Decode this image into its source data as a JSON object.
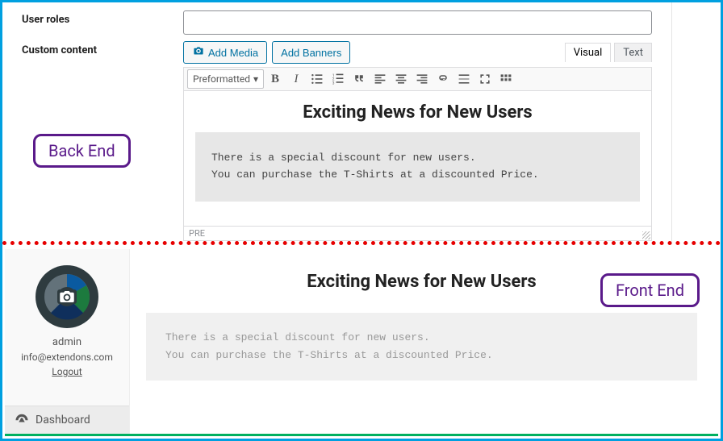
{
  "backend": {
    "fields": {
      "user_roles_label": "User roles",
      "user_roles_value": "",
      "custom_content_label": "Custom content"
    },
    "buttons": {
      "add_media": "Add Media",
      "add_banners": "Add Banners"
    },
    "editor": {
      "tabs": {
        "visual": "Visual",
        "text": "Text",
        "active": "visual"
      },
      "format_selected": "Preformatted",
      "status_path": "PRE",
      "icon_names": {
        "bold": "bold-icon",
        "italic": "italic-icon",
        "bullet_list": "bullet-list-icon",
        "number_list": "numbered-list-icon",
        "blockquote": "blockquote-icon",
        "align_left": "align-left-icon",
        "align_center": "align-center-icon",
        "align_right": "align-right-icon",
        "link": "link-icon",
        "insert_more": "insert-more-icon",
        "fullscreen": "fullscreen-icon",
        "toolbar_toggle": "toolbar-toggle-icon"
      }
    },
    "content": {
      "heading": "Exciting News for New Users",
      "body_line1": "There is a special discount for new users.",
      "body_line2": "You can purchase the T-Shirts at a discounted Price."
    },
    "callout": "Back End"
  },
  "frontend": {
    "callout": "Front End",
    "user": {
      "name": "admin",
      "email": "info@extendons.com",
      "logout": "Logout"
    },
    "nav": {
      "dashboard": "Dashboard"
    },
    "content": {
      "heading": "Exciting News for New Users",
      "body_line1": "There is a special discount for new users.",
      "body_line2": "You can purchase the T-Shirts at a discounted Price."
    }
  },
  "colors": {
    "frame_border": "#00a0e0",
    "callout_border": "#5a1a8a",
    "divider": "#e60000",
    "bottom_border": "#00b060",
    "wp_primary": "#0071a1"
  }
}
